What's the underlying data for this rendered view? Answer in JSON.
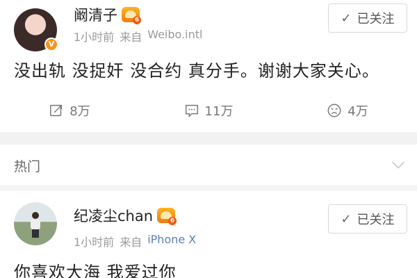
{
  "post1": {
    "username": "阚清子",
    "time": "1小时前",
    "from_label": "来自",
    "source": "Weibo.intl",
    "follow_label": "已关注",
    "content": "没出轨 没捉奸 没合约 真分手。谢谢大家关心。",
    "actions": {
      "repost_count": "8万",
      "comment_count": "11万",
      "like_count": "4万"
    },
    "avatar_icon": "user-avatar",
    "verified_icon": "verified-badge-icon"
  },
  "section": {
    "title": "热门"
  },
  "post2": {
    "username": "纪凌尘chan",
    "time": "1小时前",
    "from_label": "来自",
    "source": "iPhone X",
    "follow_label": "已关注",
    "content": "你喜欢大海 我爱过你"
  },
  "colors": {
    "accent_orange": "#f7931e",
    "link_blue": "#5b7fb1",
    "muted_text": "#9a9a9a",
    "separator": "#f2f2f2"
  }
}
